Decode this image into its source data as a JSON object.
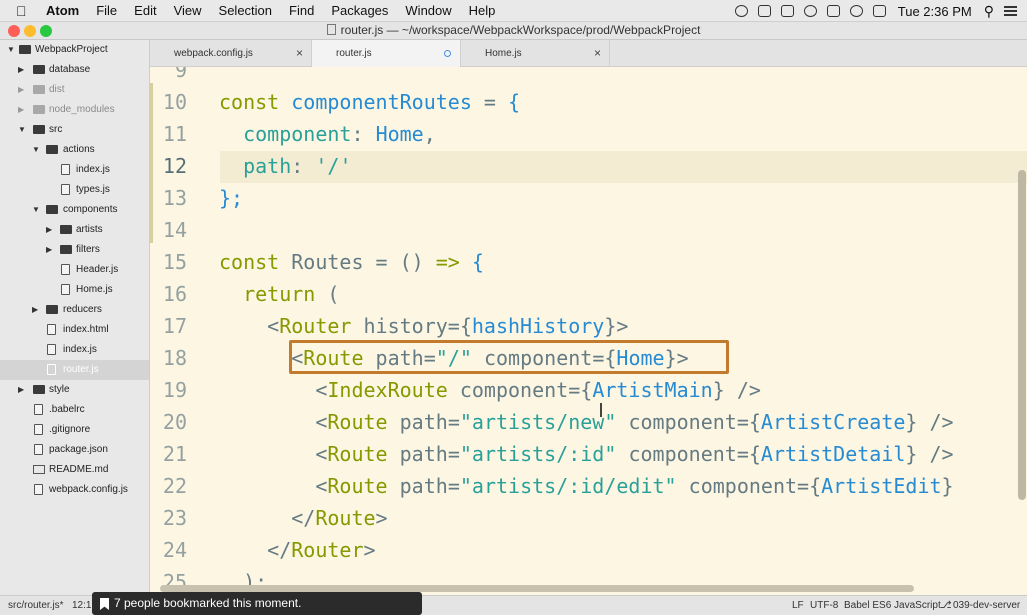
{
  "menubar": {
    "apple_icon": "apple-logo-icon",
    "items": [
      "Atom",
      "File",
      "Edit",
      "View",
      "Selection",
      "Find",
      "Packages",
      "Window",
      "Help"
    ],
    "clock": "Tue 2:36 PM",
    "tray_icons": [
      "record-icon",
      "cloud-icon",
      "ghost-icon",
      "history-icon",
      "drive-icon",
      "wifi-icon",
      "battery-icon",
      "search-icon",
      "list-icon"
    ]
  },
  "window": {
    "title": "router.js — ~/workspace/WebpackWorkspace/prod/WebpackProject"
  },
  "tree": {
    "rows": [
      {
        "label": "WebpackProject",
        "kind": "folder",
        "state": "open"
      },
      {
        "label": "database",
        "kind": "folder",
        "state": "closed"
      },
      {
        "label": "dist",
        "kind": "folder",
        "state": "closed",
        "muted": true
      },
      {
        "label": "node_modules",
        "kind": "folder",
        "state": "closed",
        "muted": true
      },
      {
        "label": "src",
        "kind": "folder",
        "state": "open"
      },
      {
        "label": "actions",
        "kind": "folder",
        "state": "open"
      },
      {
        "label": "index.js",
        "kind": "file"
      },
      {
        "label": "types.js",
        "kind": "file"
      },
      {
        "label": "components",
        "kind": "folder",
        "state": "open"
      },
      {
        "label": "artists",
        "kind": "folder",
        "state": "closed"
      },
      {
        "label": "filters",
        "kind": "folder",
        "state": "closed"
      },
      {
        "label": "Header.js",
        "kind": "file"
      },
      {
        "label": "Home.js",
        "kind": "file"
      },
      {
        "label": "reducers",
        "kind": "folder",
        "state": "closed"
      },
      {
        "label": "index.html",
        "kind": "file"
      },
      {
        "label": "index.js",
        "kind": "file"
      },
      {
        "label": "router.js",
        "kind": "file",
        "selected": true
      },
      {
        "label": "style",
        "kind": "folder",
        "state": "closed"
      },
      {
        "label": ".babelrc",
        "kind": "file"
      },
      {
        "label": ".gitignore",
        "kind": "file"
      },
      {
        "label": "package.json",
        "kind": "file"
      },
      {
        "label": "README.md",
        "kind": "book"
      },
      {
        "label": "webpack.config.js",
        "kind": "file"
      }
    ]
  },
  "tabs": [
    {
      "label": "webpack.config.js",
      "active": false,
      "modified": false
    },
    {
      "label": "router.js",
      "active": true,
      "modified": true
    },
    {
      "label": "Home.js",
      "active": false,
      "modified": false
    }
  ],
  "editor": {
    "current_line": "12",
    "lines": [
      {
        "n": "9",
        "tokens": []
      },
      {
        "n": "10",
        "tokens": [
          [
            "kw",
            "const "
          ],
          [
            "fn",
            "componentRoutes"
          ],
          [
            "plain",
            " = "
          ],
          [
            "fn",
            "{"
          ]
        ]
      },
      {
        "n": "11",
        "tokens": [
          [
            "plain",
            "  "
          ],
          [
            "str",
            "component"
          ],
          [
            "plain",
            ": "
          ],
          [
            "fn",
            "Home"
          ],
          [
            "plain",
            ","
          ]
        ]
      },
      {
        "n": "12",
        "tokens": [
          [
            "plain",
            "  "
          ],
          [
            "str",
            "path"
          ],
          [
            "plain",
            ": "
          ],
          [
            "str",
            "'/'"
          ]
        ]
      },
      {
        "n": "13",
        "tokens": [
          [
            "fn",
            "};"
          ]
        ]
      },
      {
        "n": "14",
        "tokens": []
      },
      {
        "n": "15",
        "tokens": [
          [
            "kw",
            "const "
          ],
          [
            "plain",
            "Routes = () "
          ],
          [
            "kw",
            "=>"
          ],
          [
            "plain",
            " "
          ],
          [
            "fn",
            "{"
          ]
        ]
      },
      {
        "n": "16",
        "tokens": [
          [
            "plain",
            "  "
          ],
          [
            "kw",
            "return"
          ],
          [
            "plain",
            " ("
          ]
        ]
      },
      {
        "n": "17",
        "tokens": [
          [
            "plain",
            "    <"
          ],
          [
            "tag",
            "Router"
          ],
          [
            "attr",
            " history"
          ],
          [
            "plain",
            "={"
          ],
          [
            "fn",
            "hashHistory"
          ],
          [
            "plain",
            "}>"
          ]
        ]
      },
      {
        "n": "18",
        "tokens": [
          [
            "plain",
            "      <"
          ],
          [
            "tag",
            "Route"
          ],
          [
            "attr",
            " path"
          ],
          [
            "plain",
            "="
          ],
          [
            "str",
            "\"/\""
          ],
          [
            "attr",
            " component"
          ],
          [
            "plain",
            "={"
          ],
          [
            "fn",
            "Home"
          ],
          [
            "plain",
            "}>"
          ]
        ]
      },
      {
        "n": "19",
        "tokens": [
          [
            "plain",
            "        <"
          ],
          [
            "tag",
            "IndexRoute"
          ],
          [
            "attr",
            " component"
          ],
          [
            "plain",
            "={"
          ],
          [
            "fn",
            "ArtistMain"
          ],
          [
            "plain",
            "} />"
          ]
        ]
      },
      {
        "n": "20",
        "tokens": [
          [
            "plain",
            "        <"
          ],
          [
            "tag",
            "Route"
          ],
          [
            "attr",
            " path"
          ],
          [
            "plain",
            "="
          ],
          [
            "str",
            "\"artists/new\""
          ],
          [
            "attr",
            " component"
          ],
          [
            "plain",
            "={"
          ],
          [
            "fn",
            "ArtistCreate"
          ],
          [
            "plain",
            "} />"
          ]
        ]
      },
      {
        "n": "21",
        "tokens": [
          [
            "plain",
            "        <"
          ],
          [
            "tag",
            "Route"
          ],
          [
            "attr",
            " path"
          ],
          [
            "plain",
            "="
          ],
          [
            "str",
            "\"artists/:id\""
          ],
          [
            "attr",
            " component"
          ],
          [
            "plain",
            "={"
          ],
          [
            "fn",
            "ArtistDetail"
          ],
          [
            "plain",
            "} />"
          ]
        ]
      },
      {
        "n": "22",
        "tokens": [
          [
            "plain",
            "        <"
          ],
          [
            "tag",
            "Route"
          ],
          [
            "attr",
            " path"
          ],
          [
            "plain",
            "="
          ],
          [
            "str",
            "\"artists/:id/edit\""
          ],
          [
            "attr",
            " component"
          ],
          [
            "plain",
            "={"
          ],
          [
            "fn",
            "ArtistEdit"
          ],
          [
            "plain",
            "}"
          ]
        ]
      },
      {
        "n": "23",
        "tokens": [
          [
            "plain",
            "      </"
          ],
          [
            "tag",
            "Route"
          ],
          [
            "plain",
            ">"
          ]
        ]
      },
      {
        "n": "24",
        "tokens": [
          [
            "plain",
            "    </"
          ],
          [
            "tag",
            "Router"
          ],
          [
            "plain",
            ">"
          ]
        ]
      },
      {
        "n": "25",
        "tokens": [
          [
            "plain",
            "  );"
          ]
        ]
      }
    ]
  },
  "statusbar": {
    "file": "src/router.js*",
    "position": "12:12",
    "line_ending": "LF",
    "encoding": "UTF-8",
    "grammar": "Babel ES6 JavaScript",
    "branch": "039-dev-server"
  },
  "toast": {
    "message": "7 people bookmarked this moment."
  },
  "colors": {
    "editor_bg": "#fdf6e3",
    "keyword": "#859900",
    "identifier": "#268bd2",
    "string": "#2aa198",
    "highlight_box": "#c27a2c"
  }
}
